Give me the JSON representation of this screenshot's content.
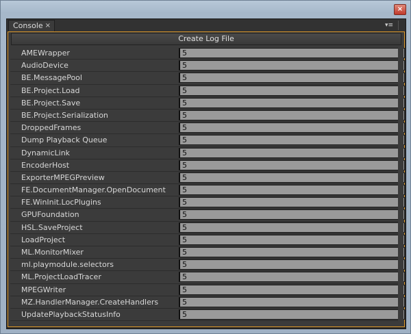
{
  "window": {
    "close_glyph": "×"
  },
  "panel": {
    "tab_label": "Console",
    "tab_close_glyph": "×",
    "menu_glyph": "▾≡"
  },
  "create_log_label": "Create Log File",
  "rows": [
    {
      "label": "AMEWrapper",
      "value": "5"
    },
    {
      "label": "AudioDevice",
      "value": "5"
    },
    {
      "label": "BE.MessagePool",
      "value": "5"
    },
    {
      "label": "BE.Project.Load",
      "value": "5"
    },
    {
      "label": "BE.Project.Save",
      "value": "5"
    },
    {
      "label": "BE.Project.Serialization",
      "value": "5"
    },
    {
      "label": "DroppedFrames",
      "value": "5"
    },
    {
      "label": "Dump Playback Queue",
      "value": "5"
    },
    {
      "label": "DynamicLink",
      "value": "5"
    },
    {
      "label": "EncoderHost",
      "value": "5"
    },
    {
      "label": "ExporterMPEGPreview",
      "value": "5"
    },
    {
      "label": "FE.DocumentManager.OpenDocument",
      "value": "5"
    },
    {
      "label": "FE.WinInit.LocPlugins",
      "value": "5"
    },
    {
      "label": "GPUFoundation",
      "value": "5"
    },
    {
      "label": "HSL.SaveProject",
      "value": "5"
    },
    {
      "label": "LoadProject",
      "value": "5"
    },
    {
      "label": "ML.MonitorMixer",
      "value": "5"
    },
    {
      "label": "ml.playmodule.selectors",
      "value": "5"
    },
    {
      "label": "ML.ProjectLoadTracer",
      "value": "5"
    },
    {
      "label": "MPEGWriter",
      "value": "5"
    },
    {
      "label": "MZ.HandlerManager.CreateHandlers",
      "value": "5"
    },
    {
      "label": "UpdatePlaybackStatusInfo",
      "value": "5"
    }
  ]
}
